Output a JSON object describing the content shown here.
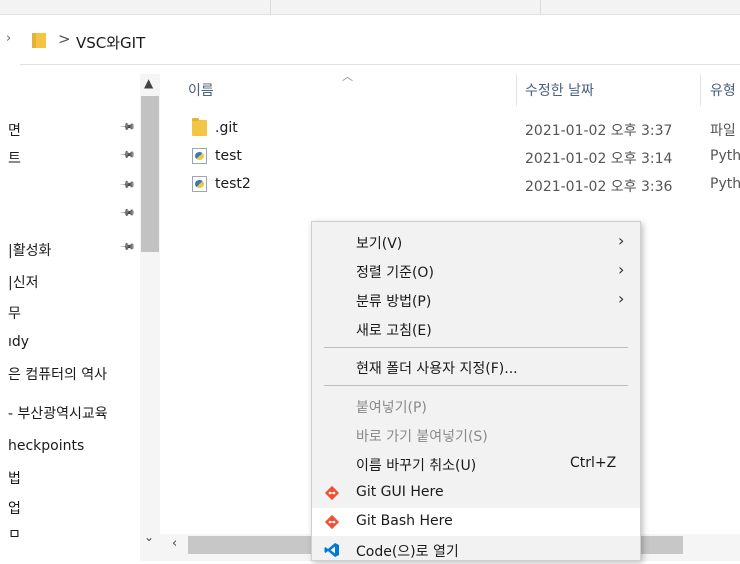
{
  "address": {
    "separator": ">",
    "path": "VSC와GIT"
  },
  "nav": {
    "items": [
      {
        "label": "면",
        "pinned": true
      },
      {
        "label": "트",
        "pinned": true
      },
      {
        "label": "",
        "pinned": true
      },
      {
        "label": "",
        "pinned": true
      },
      {
        "label": "|활성화",
        "pinned": true
      },
      {
        "label": "|신저",
        "pinned": false
      },
      {
        "label": "무",
        "pinned": false
      },
      {
        "label": "ıdy",
        "pinned": false
      },
      {
        "label": "은 컴퓨터의 역사",
        "pinned": false
      },
      {
        "label": "- 부산광역시교육",
        "pinned": false
      },
      {
        "label": "heckpoints",
        "pinned": false
      },
      {
        "label": "법",
        "pinned": false
      },
      {
        "label": "업",
        "pinned": false
      },
      {
        "label": "ㅁ",
        "pinned": false
      }
    ]
  },
  "columns": {
    "name": "이름",
    "date": "수정한 날짜",
    "type": "유형"
  },
  "files": [
    {
      "name": ".git",
      "date": "2021-01-02 오후 3:37",
      "type": "파일",
      "kind": "folder"
    },
    {
      "name": "test",
      "date": "2021-01-02 오후 3:14",
      "type": "Pyth",
      "kind": "python"
    },
    {
      "name": "test2",
      "date": "2021-01-02 오후 3:36",
      "type": "Pyth",
      "kind": "python"
    }
  ],
  "context_menu": {
    "view": "보기(V)",
    "sort": "정렬 기준(O)",
    "group": "분류 방법(P)",
    "refresh": "새로 고침(E)",
    "customize": "현재 폴더 사용자 지정(F)...",
    "paste": "붙여넣기(P)",
    "paste_shortcut": "바로 가기 붙여넣기(S)",
    "undo_rename": "이름 바꾸기 취소(U)",
    "undo_shortcut": "Ctrl+Z",
    "git_gui": "Git GUI Here",
    "git_bash": "Git Bash Here",
    "open_code": "Code(으)로 열기"
  },
  "colors": {
    "git": "#f05033",
    "vscode": "#0078d4",
    "folder": "#f4c542"
  }
}
